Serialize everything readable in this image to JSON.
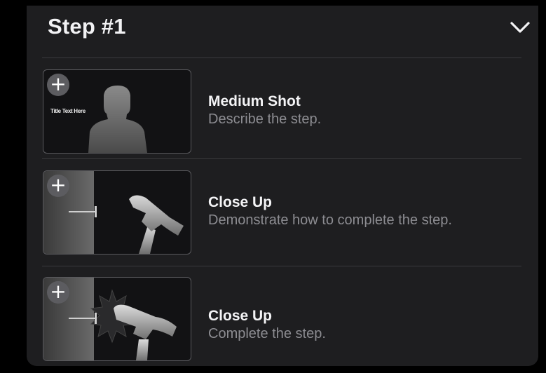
{
  "header": {
    "title": "Step #1",
    "collapse_icon": "chevron-down-icon"
  },
  "steps": [
    {
      "add_icon": "plus-icon",
      "thumb_caption": "Title Text Here",
      "thumb_art": "person-silhouette",
      "name": "Medium Shot",
      "description": "Describe the step."
    },
    {
      "add_icon": "plus-icon",
      "thumb_caption": "",
      "thumb_art": "hammer-and-nail",
      "name": "Close Up",
      "description": "Demonstrate how to complete the step."
    },
    {
      "add_icon": "plus-icon",
      "thumb_caption": "",
      "thumb_art": "hammer-impact",
      "name": "Close Up",
      "description": "Complete the step."
    }
  ],
  "colors": {
    "panel": "#1e1e20",
    "title": "#f2f2f4",
    "description": "#8d8d92"
  }
}
